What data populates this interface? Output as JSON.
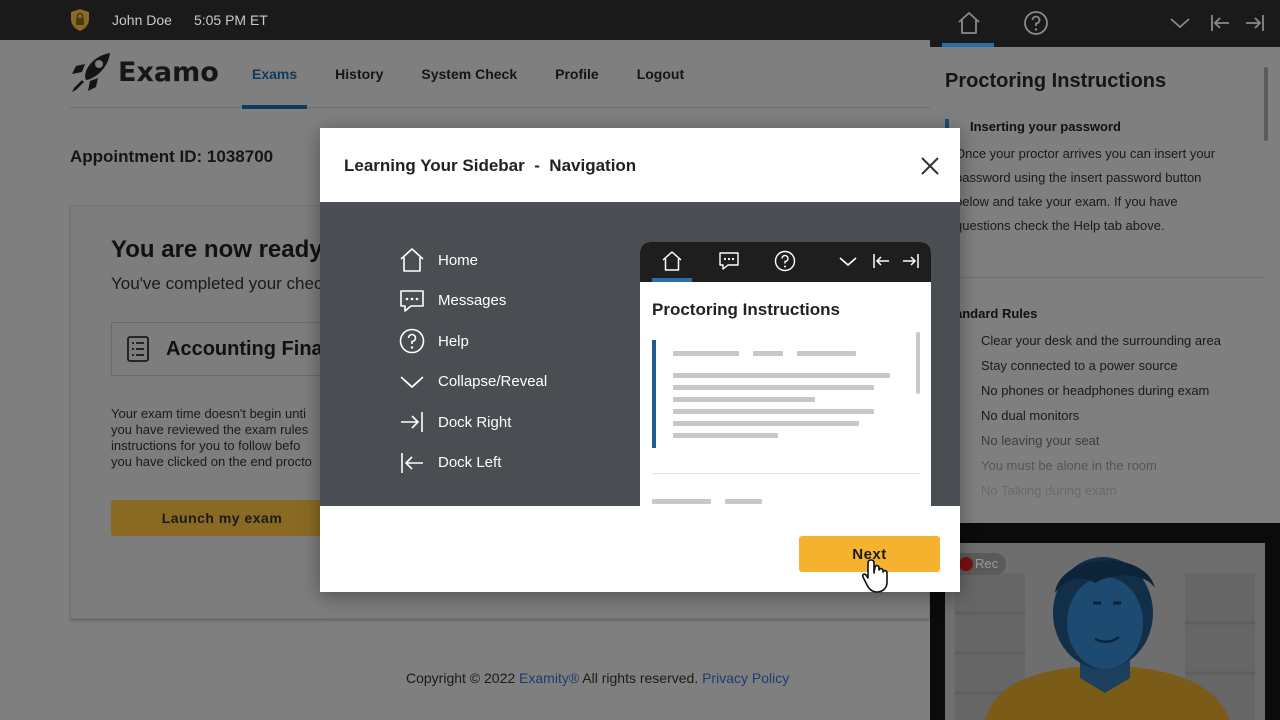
{
  "topbar": {
    "user_name": "John Doe",
    "time": "5:05 PM ET",
    "icon": "lock-shield-icon"
  },
  "brand": {
    "name": "Examo",
    "icon": "rocket-icon"
  },
  "nav": {
    "tabs": [
      {
        "label": "Exams",
        "active": true
      },
      {
        "label": "History",
        "active": false
      },
      {
        "label": "System Check",
        "active": false
      },
      {
        "label": "Profile",
        "active": false
      },
      {
        "label": "Logout",
        "active": false
      }
    ]
  },
  "appointment": {
    "label": "Appointment ID: 1038700"
  },
  "card": {
    "title": "You are now ready t",
    "subtitle": "You've completed your chec",
    "exam_name": "Accounting Final",
    "exam_icon": "document-list-icon",
    "description_lines": [
      "Your exam time doesn't begin unti",
      "you have reviewed the exam rules",
      "instructions for you to follow befo",
      "you have clicked on the end procto"
    ],
    "launch_label": "Launch my exam"
  },
  "footer": {
    "prefix": "Copyright © 2022 ",
    "company_link": "Examity®",
    "middle": " All rights reserved. ",
    "privacy_link": "Privacy Policy"
  },
  "sidebar": {
    "icons": [
      "home-icon",
      "help-icon",
      "collapse-icon",
      "dock-left-icon",
      "dock-right-icon"
    ],
    "title": "Proctoring Instructions",
    "section_title": "Inserting your password",
    "section_lines": [
      "Once your proctor arrives you can insert your",
      "password using the insert password button",
      "below and take your exam. If you have",
      "questions check the Help tab above."
    ],
    "rules_title": "andard Rules",
    "rules": [
      "Clear your desk and the surrounding area",
      "Stay connected to a power source",
      "No phones or headphones during exam",
      "No dual monitors",
      "No leaving your seat",
      "You must be alone in the room",
      "No Talking during exam",
      ""
    ],
    "video": {
      "rec_label": "Rec"
    }
  },
  "modal": {
    "title": "Learning Your Sidebar  -  Navigation",
    "legend": [
      {
        "label": "Home",
        "icon": "home-icon"
      },
      {
        "label": "Messages",
        "icon": "messages-icon"
      },
      {
        "label": "Help",
        "icon": "help-icon"
      },
      {
        "label": "Collapse/Reveal",
        "icon": "chevron-down-icon"
      },
      {
        "label": "Dock Right",
        "icon": "dock-right-icon"
      },
      {
        "label": "Dock Left",
        "icon": "dock-left-icon"
      }
    ],
    "preview": {
      "title": "Proctoring Instructions"
    },
    "next_label": "Next"
  },
  "colors": {
    "accent": "#f5b22e",
    "primary": "#1d5c94",
    "dark": "#1a1a1a"
  }
}
